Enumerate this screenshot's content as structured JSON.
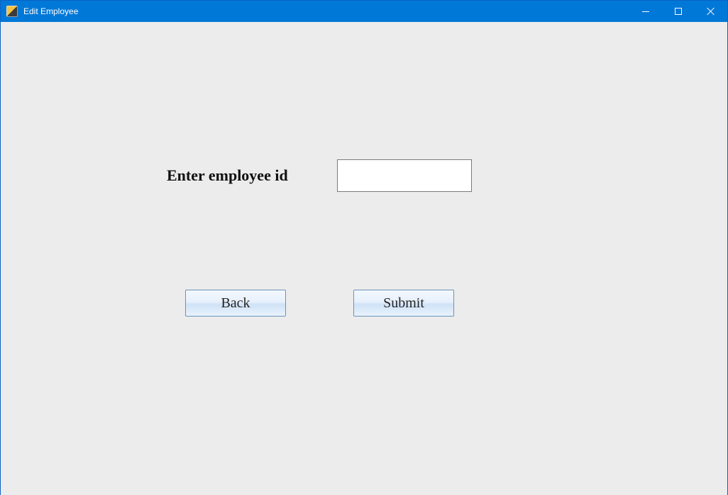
{
  "window": {
    "title": "Edit Employee"
  },
  "form": {
    "label": "Enter employee id",
    "employee_id_value": ""
  },
  "buttons": {
    "back": "Back",
    "submit": "Submit"
  }
}
